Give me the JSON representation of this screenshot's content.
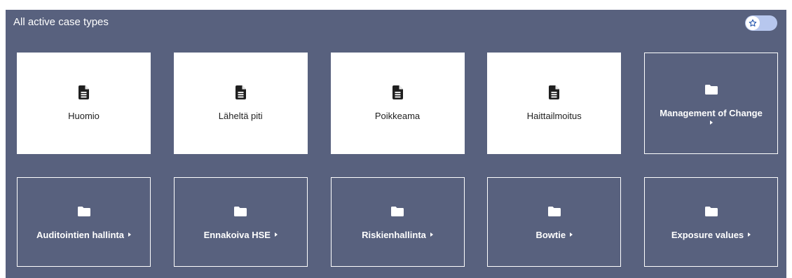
{
  "header": {
    "title": "All active case types",
    "toggle_state": "on",
    "toggle_icon": "star-icon"
  },
  "colors": {
    "panel_bg": "#58617e",
    "toggle_bg": "#b7c7ee",
    "tile_bg": "#ffffff"
  },
  "tiles": [
    {
      "label": "Huomio",
      "type": "document",
      "icon": "file-icon"
    },
    {
      "label": "Läheltä piti",
      "type": "document",
      "icon": "file-icon"
    },
    {
      "label": "Poikkeama",
      "type": "document",
      "icon": "file-icon"
    },
    {
      "label": "Haittailmoitus",
      "type": "document",
      "icon": "file-icon"
    },
    {
      "label": "Management of Change",
      "type": "folder",
      "icon": "folder-icon"
    },
    {
      "label": "Auditointien hallinta",
      "type": "folder",
      "icon": "folder-icon"
    },
    {
      "label": "Ennakoiva HSE",
      "type": "folder",
      "icon": "folder-icon"
    },
    {
      "label": "Riskienhallinta",
      "type": "folder",
      "icon": "folder-icon"
    },
    {
      "label": "Bowtie",
      "type": "folder",
      "icon": "folder-icon"
    },
    {
      "label": "Exposure values",
      "type": "folder",
      "icon": "folder-icon"
    }
  ]
}
